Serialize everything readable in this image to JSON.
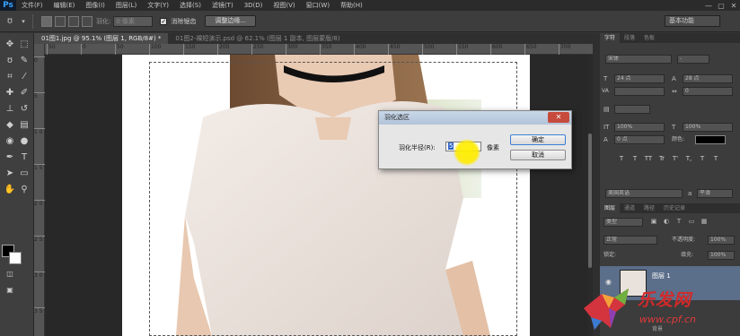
{
  "app": {
    "logo": "Ps",
    "menu": [
      "文件(F)",
      "编辑(E)",
      "图像(I)",
      "图层(L)",
      "文字(Y)",
      "选择(S)",
      "滤镜(T)",
      "3D(D)",
      "视图(V)",
      "窗口(W)",
      "帮助(H)"
    ],
    "window_controls": [
      "—",
      "▢",
      "✕"
    ]
  },
  "options_bar": {
    "feather_label": "羽化:",
    "feather_value": "0 像素",
    "antialias_label": "消除锯齿",
    "refine_button": "调整边缘...",
    "workspace": "基本功能"
  },
  "document_tabs": [
    {
      "label": "01图1.jpg @ 95.1% (图层 1, RGB/8#) *",
      "active": true
    },
    {
      "label": "01图2-裸短演示.psd @ 62.1% (图层 1 副本, 图层蒙版/8)",
      "active": false
    }
  ],
  "ruler": {
    "h_ticks": [
      "50",
      "0",
      "50",
      "100",
      "150",
      "200",
      "250",
      "300",
      "350",
      "400",
      "450",
      "500",
      "550",
      "600",
      "650",
      "700"
    ],
    "v_ticks": [
      "0",
      "5",
      "1 0",
      "1 5",
      "2 0",
      "2 5",
      "3 0",
      "3 5"
    ]
  },
  "feather_dialog": {
    "title": "羽化选区",
    "close": "✕",
    "radius_label": "羽化半径(R):",
    "radius_value": "5",
    "unit": "像素",
    "ok_label": "确定",
    "cancel_label": "取消"
  },
  "character_panel": {
    "tabs": [
      "字符",
      "段落",
      "色板"
    ],
    "font_family": "宋体",
    "font_style": "-",
    "font_size": "24 点",
    "leading": "28 点",
    "tracking_label": "VA",
    "kerning": "0",
    "scale_v": "100%",
    "scale_h": "100%",
    "baseline": "0 点",
    "color_label": "颜色:",
    "language": "美国英语",
    "aa_label": "a",
    "aa_value": "平滑",
    "type_styles": [
      "T",
      "T",
      "TT",
      "Tr",
      "T'",
      "T,",
      "T",
      "T"
    ]
  },
  "layers_panel": {
    "tabs": [
      "图层",
      "通道",
      "路径",
      "历史记录"
    ],
    "filter_kind": "类型",
    "blend_mode": "正常",
    "opacity_label": "不透明度:",
    "opacity": "100%",
    "lock_label": "锁定:",
    "fill_label": "填充:",
    "fill": "100%",
    "layers": [
      {
        "name": "图层 1",
        "visible": true
      },
      {
        "name": "背景",
        "visible": true
      }
    ]
  },
  "watermark": {
    "text": "乐发网",
    "url": "www.cpf.cn"
  },
  "colors": {
    "accent_blue": "#3b7fd4",
    "dialog_close": "#c64b3d",
    "watermark_red": "#d22a2a",
    "layer_selected": "#5b6e8a"
  }
}
